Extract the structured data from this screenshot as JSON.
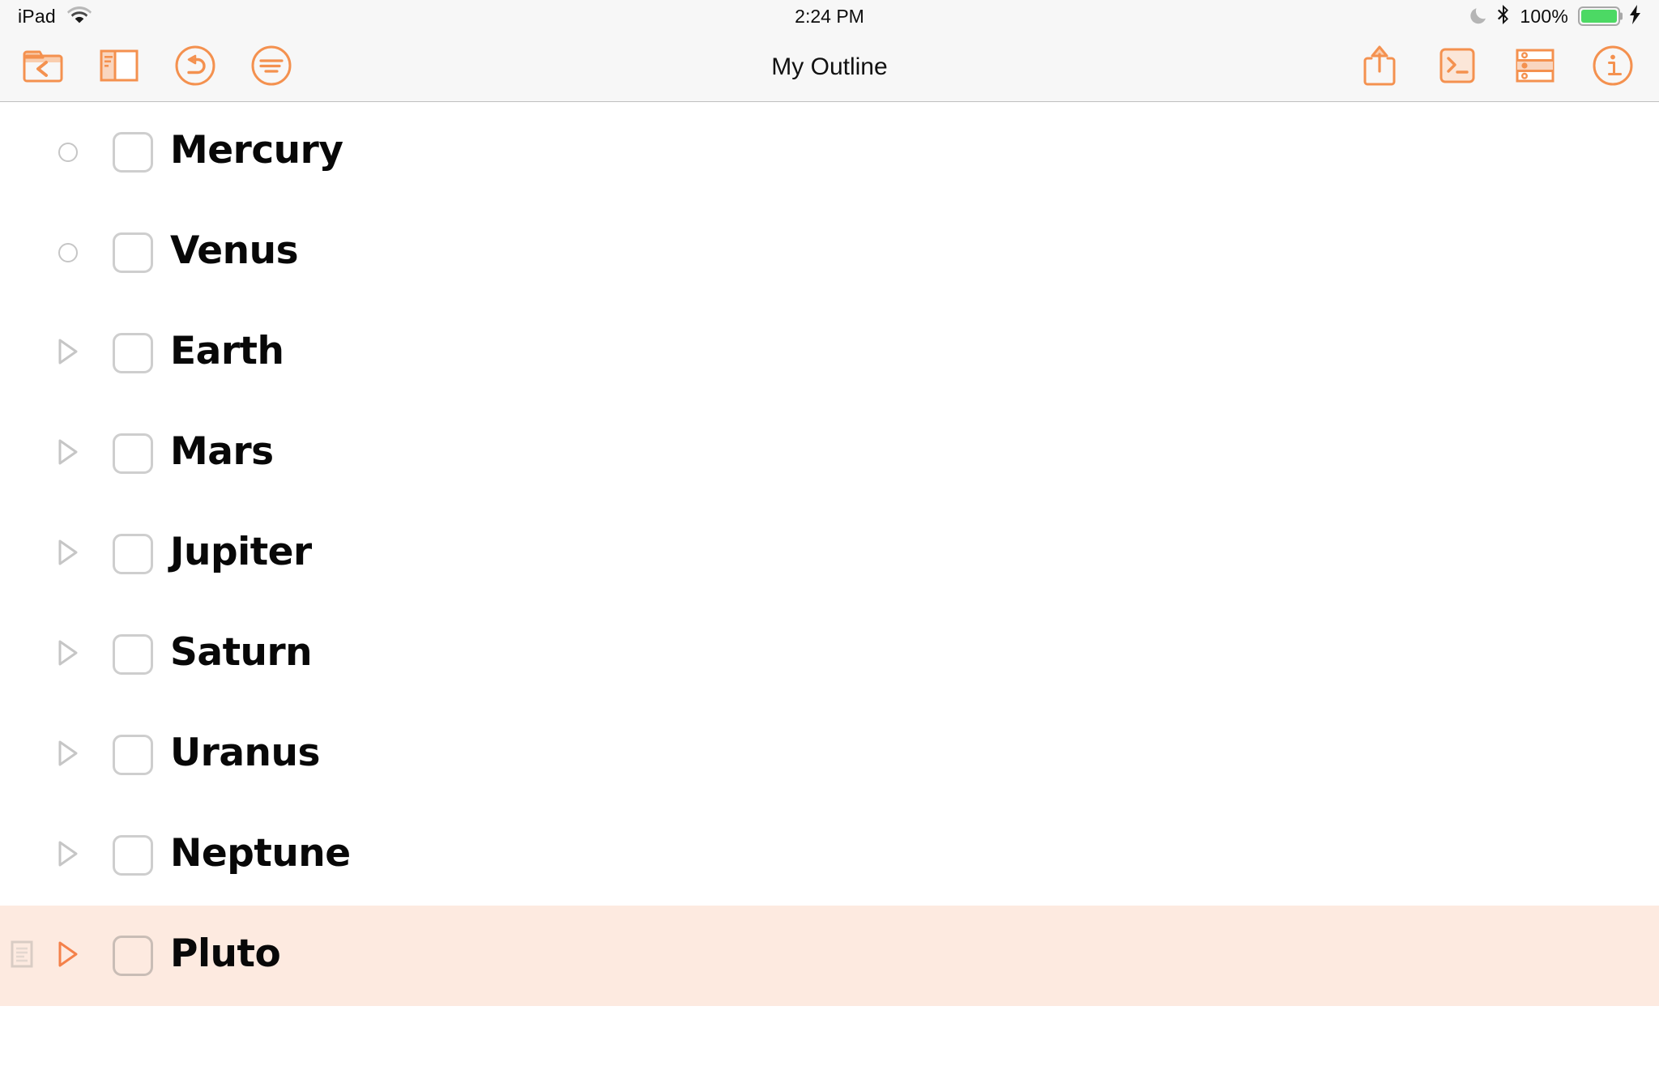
{
  "status_bar": {
    "device": "iPad",
    "wifi_icon": "wifi-icon",
    "time": "2:24 PM",
    "do_not_disturb_icon": "moon-icon",
    "bluetooth_icon": "bluetooth-icon",
    "battery_percent": "100%",
    "battery_icon": "battery-icon",
    "charging_icon": "lightning-bolt-icon",
    "battery_color": "#4CD964"
  },
  "toolbar": {
    "title": "My Outline",
    "accent_color": "#F4914F",
    "background": "#F7F7F7",
    "left_items": [
      {
        "name": "back-to-documents-button",
        "icon": "folder-back-icon"
      },
      {
        "name": "sidebar-toggle-button",
        "icon": "split-view-icon"
      },
      {
        "name": "undo-button",
        "icon": "undo-circle-icon"
      },
      {
        "name": "outline-filter-button",
        "icon": "filter-lines-circle-icon"
      }
    ],
    "right_items": [
      {
        "name": "share-button",
        "icon": "share-upload-icon"
      },
      {
        "name": "script-console-button",
        "icon": "terminal-prompt-icon"
      },
      {
        "name": "row-styles-button",
        "icon": "stacked-rows-icon"
      },
      {
        "name": "info-inspector-button",
        "icon": "info-circle-icon"
      }
    ]
  },
  "outline": {
    "selected_row_color": "#FDEAE0",
    "rows": [
      {
        "label": "Mercury",
        "bullet": "circle",
        "expandable": false,
        "checked": false,
        "selected": false,
        "has_note": false
      },
      {
        "label": "Venus",
        "bullet": "circle",
        "expandable": false,
        "checked": false,
        "selected": false,
        "has_note": false
      },
      {
        "label": "Earth",
        "bullet": "triangle",
        "expandable": true,
        "checked": false,
        "selected": false,
        "has_note": false
      },
      {
        "label": "Mars",
        "bullet": "triangle",
        "expandable": true,
        "checked": false,
        "selected": false,
        "has_note": false
      },
      {
        "label": "Jupiter",
        "bullet": "triangle",
        "expandable": true,
        "checked": false,
        "selected": false,
        "has_note": false
      },
      {
        "label": "Saturn",
        "bullet": "triangle",
        "expandable": true,
        "checked": false,
        "selected": false,
        "has_note": false
      },
      {
        "label": "Uranus",
        "bullet": "triangle",
        "expandable": true,
        "checked": false,
        "selected": false,
        "has_note": false
      },
      {
        "label": "Neptune",
        "bullet": "triangle",
        "expandable": true,
        "checked": false,
        "selected": false,
        "has_note": false
      },
      {
        "label": "Pluto",
        "bullet": "triangle",
        "expandable": true,
        "checked": false,
        "selected": true,
        "has_note": true
      }
    ]
  }
}
